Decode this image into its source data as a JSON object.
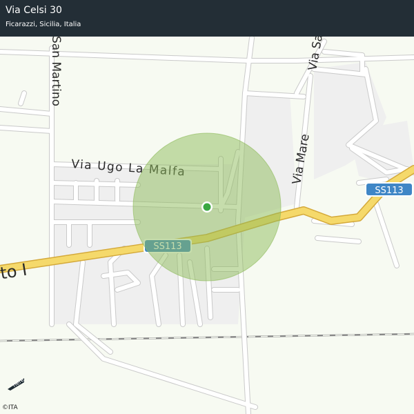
{
  "header": {
    "title": "Via Celsi 30",
    "subtitle": "Ficarazzi, Sicilia, Italia"
  },
  "map": {
    "street_labels": [
      "San Martino",
      "Via Ugo La Malfa",
      "Via Mare",
      "Via Sandro",
      "rto I"
    ],
    "road_shields": [
      "SS113",
      "SS113"
    ],
    "colors": {
      "background": "#f7faf2",
      "header": "#232e36",
      "accuracy_circle": "#8dbb5a",
      "location_dot": "#3aa842",
      "highway": "#f5d96b",
      "shield": "#3f86c6"
    },
    "marker": "current-location-dot"
  },
  "footer": {
    "logo_text": "here",
    "attribution": "©ITA"
  }
}
